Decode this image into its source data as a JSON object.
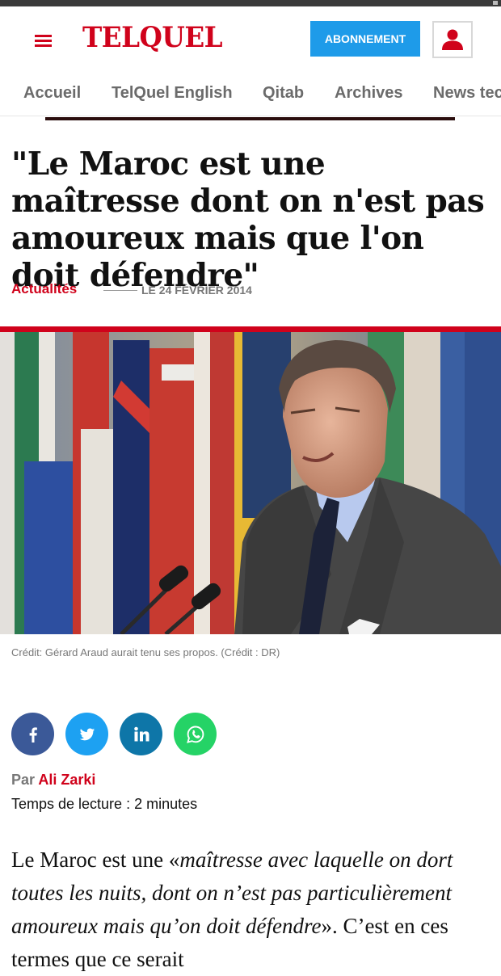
{
  "header": {
    "logo_text": "TELQUEL",
    "subscribe_label": "ABONNEMENT",
    "brand_color": "#d0021b",
    "accent_color": "#1e9be9",
    "menu_icon": "hamburger-icon",
    "account_icon": "user-icon"
  },
  "nav": {
    "items": [
      "Accueil",
      "TelQuel English",
      "Qitab",
      "Archives",
      "News tec"
    ]
  },
  "article": {
    "title": "\"Le Maroc est une maîtresse dont on n'est pas amoureux mais que l'on doit défendre\"",
    "category": "Actualités",
    "date": "LE 24 FÉVRIER 2014",
    "image_caption": "Crédit: Gérard Araud aurait tenu ses propos. (Crédit : DR)",
    "share_icons": [
      "facebook-icon",
      "twitter-icon",
      "linkedin-icon",
      "whatsapp-icon"
    ],
    "share_colors": [
      "#3b5998",
      "#1da1f2",
      "#0e76a8",
      "#25d366"
    ],
    "by_label": "Par",
    "author": "Ali Zarki",
    "reading_time": "Temps de lecture : 2 minutes",
    "body": {
      "part1": "Le Maroc est une «",
      "part2_italic": "maîtresse avec laquelle on dort toutes les nuits, dont on n’est pas particulièrement amoureux mais qu’on doit défendre",
      "part3": "». C’est en ces termes que ce serait"
    }
  }
}
